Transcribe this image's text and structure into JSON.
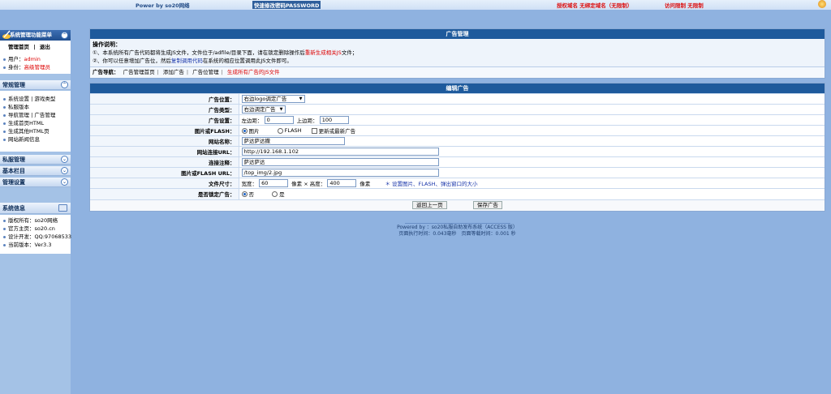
{
  "topbar": {
    "powered": "Power by so20网络",
    "change_password": "快速修改密码PASSWORD",
    "domain_binding": "授权域名 无绑定域名（无限制）",
    "access_limit": "访问限制 无限制"
  },
  "sidebar": {
    "menu_title": "系统管理功能菜单",
    "home_link": "管理首页",
    "logout_link": "退出",
    "user_label": "用户：",
    "user_value": "admin",
    "identity_label": "身份：",
    "identity_value": "高级管理员",
    "sections": {
      "common": "常规管理",
      "private": "私服管理",
      "basic": "基本栏目",
      "manage": "管理设置",
      "sysinfo": "系统信息"
    },
    "common_items": {
      "system_settings": "系统设置",
      "game_types": "游戏类型",
      "private_version": "私服版本",
      "nav_manage": "导航管理",
      "ad_manage": "广告管理",
      "gen_home": "生成首页HTML",
      "gen_other": "生成其他HTML页",
      "site_info": "网站新闻信息"
    },
    "info_items": [
      "版权所有：so20网络",
      "官方主页：so20.cn",
      "设计开发：QQ:97068533",
      "当前版本：Ver3.3"
    ]
  },
  "ad_panel": {
    "title": "广告管理",
    "tip_heading": "操作说明：",
    "tip_line1_a": "①、本系统所有广告代码都将生成JS文件，文件位于/adfile/目录下面，请在锁定删除操作后",
    "tip_line1_b": "重新生成相关JS",
    "tip_line1_c": "文件；",
    "tip_line2_a": "②、你可以任意增加广告位，然后",
    "tip_line2_b": "复制调用代码",
    "tip_line2_c": "在系统的相应位置调用此JS文件即可。",
    "nav_label": "广告导航：",
    "nav_items": [
      "广告管理首页",
      "添加广告",
      "广告位管理"
    ],
    "nav_generate": "生成所有广告的JS文件"
  },
  "edit_panel": {
    "title": "编辑广告",
    "position_label": "广告位置：",
    "position_value": "右边logo调定广告",
    "type_label": "广告类型：",
    "type_value": "右边调定广告",
    "settings_label": "广告设置：",
    "left_label": "左边距：",
    "left_value": "0",
    "top_label": "上边距：",
    "top_value": "100",
    "media_label": "图片或FLASH：",
    "media_image": "图片",
    "media_flash": "FLASH",
    "media_update": "更新或最新广告",
    "site_name_label": "网站名称：",
    "site_name_value": "萨达萨达撒",
    "url_label": "网站连接URL：",
    "url_value": "http://192.168.1.102",
    "note_label": "连接注释：",
    "note_value": "萨达萨达",
    "file_url_label": "图片或FLASH URL：",
    "file_url_value": "/top_img/2.jpg",
    "size_label": "文件尺寸：",
    "width_label": "宽度：",
    "width_value": "60",
    "px1": "像素 × 高度：",
    "height_value": "400",
    "px2": "像素",
    "size_hint": "＊ 设置图片、FLASH、弹出窗口的大小",
    "lock_label": "是否锁定广告：",
    "lock_no": "否",
    "lock_yes": "是",
    "back_button": "返回上一页",
    "save_button": "保存广告"
  },
  "footer": {
    "powered": "Powered by ：so20私服自助发布系统（ACCESS 版）",
    "runtime": "页面执行时间：0.043毫秒　页面等载时间：0.001 秒"
  }
}
